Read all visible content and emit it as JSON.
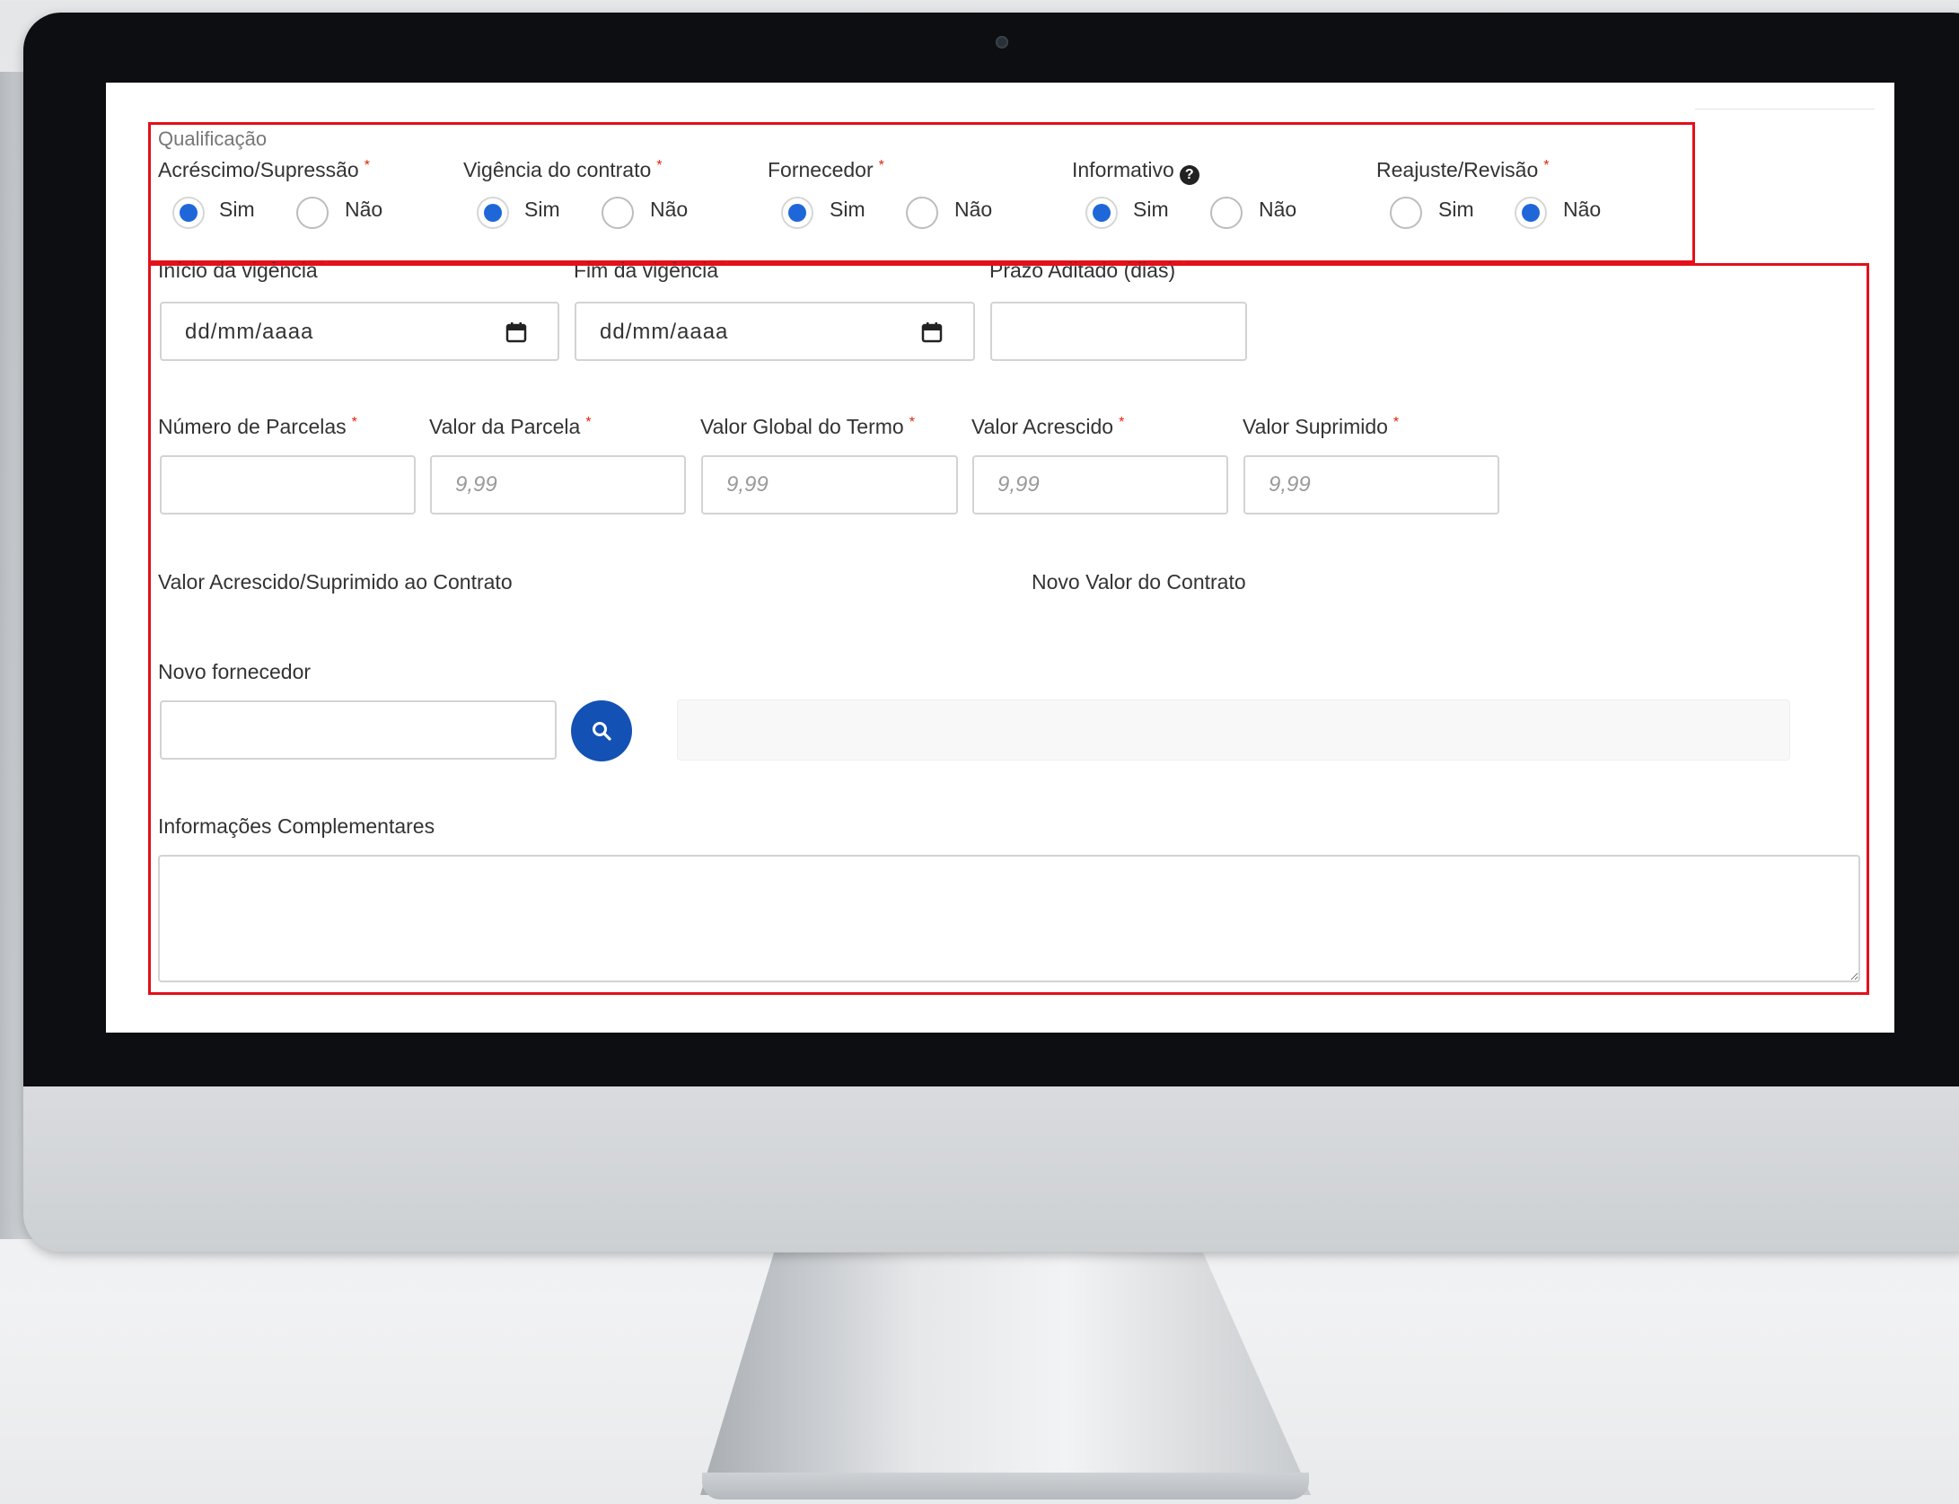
{
  "form": {
    "qualificacao_legend": "Qualificação",
    "radio_groups": [
      {
        "label": "Acréscimo/Supressão",
        "required": "*",
        "options": [
          "Sim",
          "Não"
        ],
        "selected": "Sim"
      },
      {
        "label": "Vigência do contrato",
        "required": "*",
        "options": [
          "Sim",
          "Não"
        ],
        "selected": "Sim"
      },
      {
        "label": "Fornecedor",
        "required": "*",
        "options": [
          "Sim",
          "Não"
        ],
        "selected": "Sim"
      },
      {
        "label": "Informativo",
        "help_icon": "question-circle-icon",
        "options": [
          "Sim",
          "Não"
        ],
        "selected": "Sim"
      },
      {
        "label": "Reajuste/Revisão",
        "required": "*",
        "options": [
          "Sim",
          "Não"
        ],
        "selected": "Não"
      }
    ],
    "vigencia": {
      "inicio_label": "Início da vigência",
      "fim_label": "Fim da vigência",
      "prazo_label": "Prazo Aditado (dias)",
      "date_placeholder": "dd/mm/aaaa",
      "required": "*"
    },
    "valores": {
      "numero_parcelas_label": "Número de Parcelas",
      "valor_parcela_label": "Valor da Parcela",
      "valor_global_label": "Valor Global do Termo",
      "valor_acrescido_label": "Valor Acrescido",
      "valor_suprimido_label": "Valor Suprimido",
      "money_placeholder": "9,99",
      "required": "*"
    },
    "resumo": {
      "acrescido_suprimido_label": "Valor Acrescido/Suprimido ao Contrato",
      "novo_valor_label": "Novo Valor do Contrato"
    },
    "novo_fornecedor_label": "Novo fornecedor",
    "info_complementares_label": "Informações Complementares"
  },
  "colors": {
    "accent": "#1f67d9",
    "search_button": "#1351b4",
    "required": "#e52207",
    "highlight_box": "#e3101a"
  },
  "icons": {
    "search": "search-icon",
    "calendar": "calendar-icon",
    "help": "question-circle-icon"
  }
}
